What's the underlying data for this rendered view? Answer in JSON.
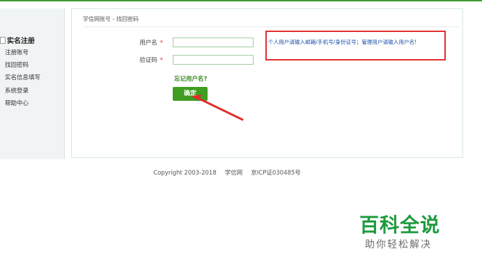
{
  "sidebar": {
    "title": "实名注册",
    "items": [
      "注册账号",
      "找回密码",
      "实名信息填写",
      "系统登录",
      "帮助中心"
    ]
  },
  "breadcrumb": "学信网账号 - 找回密码",
  "form": {
    "username_label": "用户名",
    "captcha_label": "验证码",
    "required_mark": "*",
    "forgot_link": "忘记用户名?",
    "submit_label": "确定"
  },
  "hint": "个人用户请输入邮箱/手机号/身份证号；管理用户请输入用户名!",
  "footer": {
    "copyright": "Copyright 2003-2018",
    "site": "学信网",
    "icp": "京ICP证030485号"
  },
  "watermark": {
    "title": "百科全说",
    "subtitle": "助你轻松解决"
  },
  "colors": {
    "accent": "#3f9d22",
    "annotation": "#e02d2d",
    "hint_text": "#1a4fa8",
    "watermark": "#1d9a3c"
  }
}
